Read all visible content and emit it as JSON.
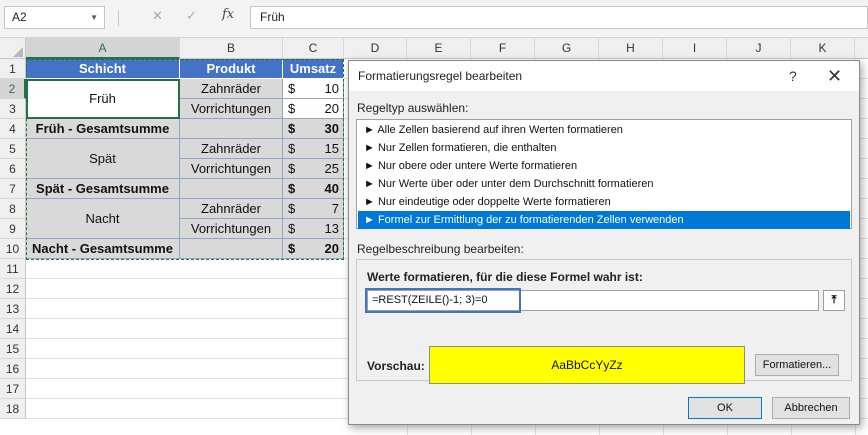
{
  "formula_bar": {
    "name_box": "A2",
    "cancel_icon": "✕",
    "enter_icon": "✓",
    "fx_label": "fx",
    "content": "Früh"
  },
  "columns": [
    "A",
    "B",
    "C",
    "D",
    "E",
    "F",
    "G",
    "H",
    "I",
    "J",
    "K"
  ],
  "rows": [
    "1",
    "2",
    "3",
    "4",
    "5",
    "6",
    "7",
    "8",
    "9",
    "10",
    "11",
    "12",
    "13",
    "14",
    "15",
    "16",
    "17",
    "18"
  ],
  "table": {
    "headers": [
      "Schicht",
      "Produkt",
      "Umsatz"
    ],
    "currency": "$",
    "shift_frueh": "Früh",
    "shift_spaet": "Spät",
    "shift_nacht": "Nacht",
    "frueh_total": "Früh - Gesamtsumme",
    "spaet_total": "Spät - Gesamtsumme",
    "nacht_total": "Nacht - Gesamtsumme",
    "p_zahnraeder": "Zahnräder",
    "p_vorrichtungen": "Vorrichtungen",
    "v2": "10",
    "v3": "20",
    "v4": "30",
    "v5": "15",
    "v6": "25",
    "v7": "40",
    "v8": "7",
    "v9": "13",
    "v10": "20"
  },
  "dialog": {
    "title": "Formatierungsregel bearbeiten",
    "help": "?",
    "close": "✕",
    "rule_type_label": "Regeltyp auswählen:",
    "rule_types": [
      "► Alle Zellen basierend auf ihren Werten formatieren",
      "► Nur Zellen formatieren, die enthalten",
      "► Nur obere oder untere Werte formatieren",
      "► Nur Werte über oder unter dem Durchschnitt formatieren",
      "► Nur eindeutige oder doppelte Werte formatieren",
      "► Formel zur Ermittlung der zu formatierenden Zellen verwenden"
    ],
    "selected_rule_index": 5,
    "desc_label": "Regelbeschreibung bearbeiten:",
    "formula_label": "Werte formatieren, für die diese Formel wahr ist:",
    "formula": "=REST(ZEILE()-1; 3)=0",
    "collapse_icon": "⤒",
    "preview_label": "Vorschau:",
    "preview_text": "AaBbCcYyZz",
    "preview_color": "#ffff00",
    "format_button": "Formatieren...",
    "ok_button": "OK",
    "cancel_button": "Abbrechen"
  },
  "colors": {
    "header_blue": "#4472c4",
    "gray_fill": "#d9d9d9",
    "excel_green": "#217346",
    "selection_blue": "#0078d7"
  }
}
